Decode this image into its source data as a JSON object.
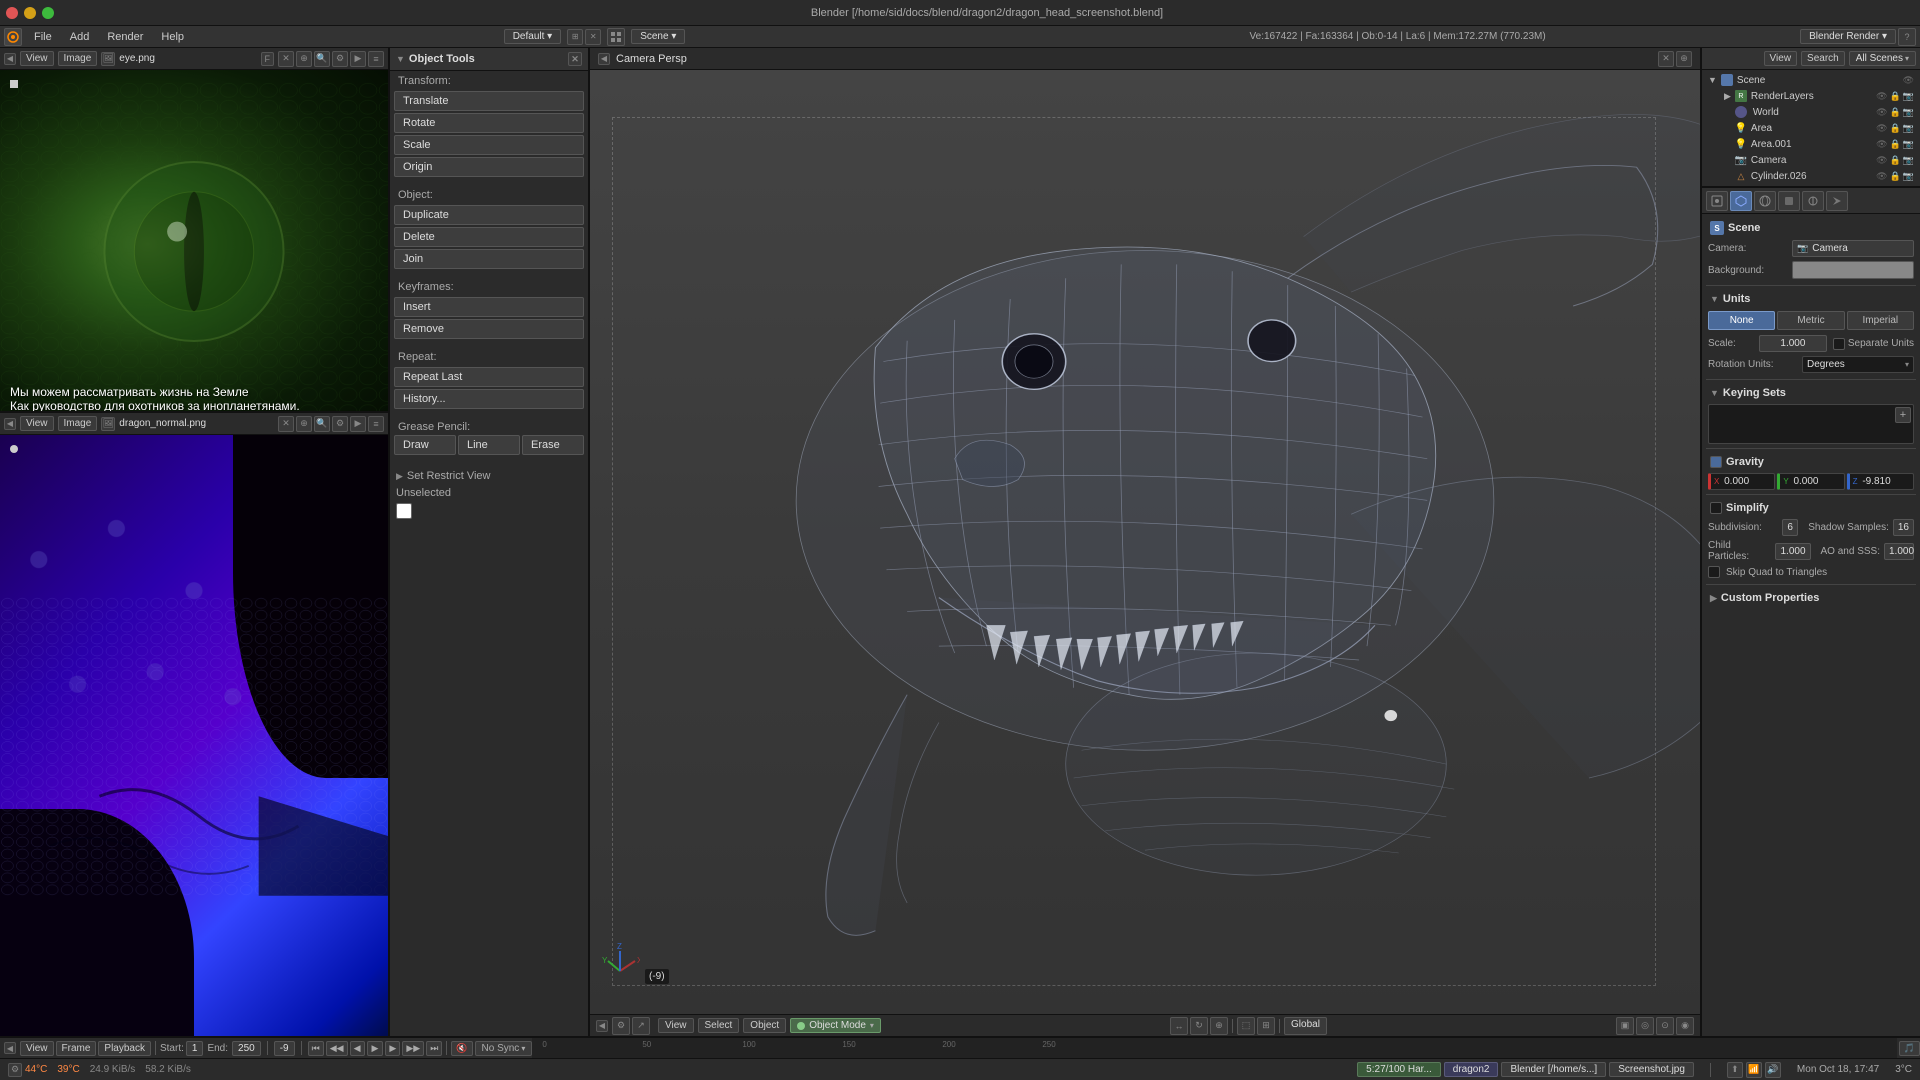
{
  "window": {
    "title": "Blender [/home/sid/docs/blend/dragon2/dragon_head_screenshot.blend]"
  },
  "top_bar": {
    "window_controls": [
      "close",
      "minimize",
      "maximize"
    ],
    "engine": "Blender Render",
    "scene": "Scene",
    "default_layout": "Default",
    "info_stats": "Ve:167422 | Fa:163364 | Ob:0-14 | La:6 | Mem:172.27M (770.23M)"
  },
  "menu": {
    "items": [
      "File",
      "Add",
      "Render",
      "Help"
    ]
  },
  "left_top_viewport": {
    "header": {
      "buttons": [
        "View",
        "Image"
      ],
      "filename": "eye.png",
      "controls": [
        "F"
      ]
    },
    "overlay_text_line1": "Мы можем рассматривать жизнь на Земле",
    "overlay_text_line2": "Как руководство для охотников за инопланетянами."
  },
  "left_bottom_viewport": {
    "header": {
      "buttons": [
        "View",
        "Image"
      ],
      "filename": "dragon_normal.png"
    }
  },
  "object_tools": {
    "title": "Object Tools",
    "transform_label": "Transform:",
    "transform_buttons": [
      "Translate",
      "Rotate",
      "Scale"
    ],
    "origin_btn": "Origin",
    "object_label": "Object:",
    "object_buttons": [
      "Duplicate",
      "Delete",
      "Join"
    ],
    "keyframes_label": "Keyframes:",
    "keyframe_buttons": [
      "Insert",
      "Remove"
    ],
    "repeat_label": "Repeat:",
    "repeat_buttons": [
      "Repeat Last",
      "History..."
    ],
    "grease_pencil_label": "Grease Pencil:",
    "grease_buttons": [
      "Draw",
      "Line",
      "Erase"
    ],
    "set_restrict_view_label": "Set Restrict View",
    "unselected_label": "Unselected",
    "unselected_color": "#ffffff"
  },
  "main_viewport": {
    "header": "Camera Persp",
    "coord_text": "(-9)",
    "bottom_toolbar": {
      "view_btn": "View",
      "select_btn": "Select",
      "object_btn": "Object",
      "mode_btn": "Object Mode",
      "global_btn": "Global"
    }
  },
  "right_panel": {
    "header_buttons": [
      "View",
      "Search"
    ],
    "scenes_dropdown": "All Scenes",
    "outliner": {
      "title": "Scene",
      "items": [
        {
          "label": "Scene",
          "icon": "scene",
          "level": 0,
          "type": "scene"
        },
        {
          "label": "RenderLayers",
          "icon": "renderlayer",
          "level": 1,
          "type": "renderlayer"
        },
        {
          "label": "World",
          "icon": "world",
          "level": 1,
          "type": "world"
        },
        {
          "label": "Area",
          "icon": "area",
          "level": 1,
          "type": "area"
        },
        {
          "label": "Area.001",
          "icon": "area",
          "level": 1,
          "type": "area"
        },
        {
          "label": "Camera",
          "icon": "camera",
          "level": 1,
          "type": "camera"
        },
        {
          "label": "Cylinder.026",
          "icon": "mesh",
          "level": 1,
          "type": "mesh"
        }
      ]
    },
    "properties": {
      "icon_tabs": [
        "render",
        "scene",
        "world",
        "object",
        "constraints",
        "modifier"
      ],
      "active_tab": "scene",
      "scene_section": {
        "label": "Scene",
        "camera_label": "Camera:",
        "camera_value": "Camera",
        "background_label": "Background:"
      },
      "units_section": {
        "label": "Units",
        "buttons": [
          "None",
          "Metric",
          "Imperial"
        ],
        "active_button": "None",
        "scale_label": "Scale:",
        "scale_value": "1.000",
        "separate_units_label": "Separate Units",
        "rotation_label": "Rotation Units:",
        "rotation_value": "Degrees"
      },
      "keying_sets_section": {
        "label": "Keying Sets"
      },
      "gravity_section": {
        "label": "Gravity",
        "x_label": "X",
        "x_value": "0.000",
        "y_label": "Y",
        "y_value": "0.000",
        "z_label": "Z",
        "z_value": "-9.810"
      },
      "simplify_section": {
        "label": "Simplify",
        "subdivision_label": "Subdivision:",
        "subdivision_value": "6",
        "shadow_samples_label": "Shadow Samples:",
        "shadow_samples_value": "16",
        "child_particles_label": "Child Particles:",
        "child_particles_value": "1.000",
        "ao_sss_label": "AO and SSS:",
        "ao_sss_value": "1.000",
        "skip_quad_label": "Skip Quad to Triangles"
      },
      "custom_properties_section": {
        "label": "Custom Properties"
      }
    }
  },
  "timeline": {
    "start": "Start: 1",
    "end": "End: 250",
    "current": "-9",
    "sync_label": "No Sync",
    "markers": [
      0,
      50,
      100,
      150,
      200,
      250
    ],
    "buttons": [
      "View",
      "Frame",
      "Playback"
    ]
  },
  "status_bar": {
    "temperature1": "44°C",
    "temperature2": "39°C",
    "memory": "24.9 KiB/s",
    "disk": "58.2 KiB/s",
    "particles": "5:27/100 Har...",
    "scene": "dragon2",
    "app": "Blender [/home/s...]",
    "screenshot": "Screenshot.jpg",
    "time": "Mon Oct 18, 17:47",
    "temp_sys": "3°C"
  }
}
